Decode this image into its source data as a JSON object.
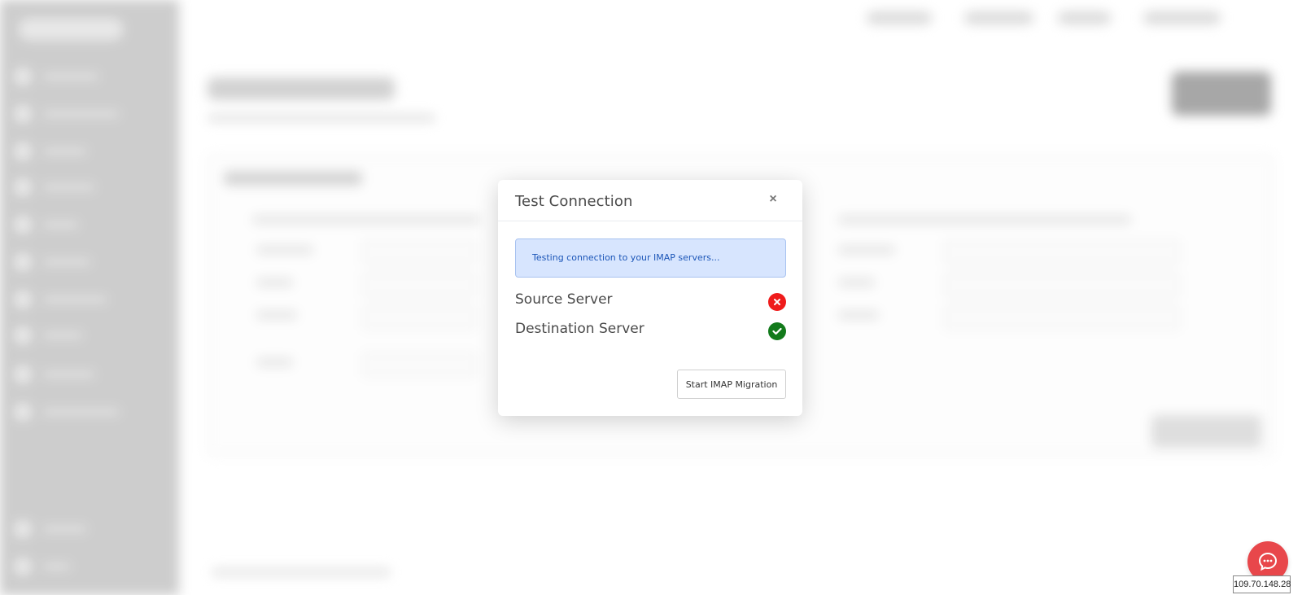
{
  "modal": {
    "title": "Test Connection",
    "close_label": "×",
    "alert_text": "Testing connection to your IMAP servers...",
    "servers": [
      {
        "label": "Source Server",
        "status": "failed",
        "icon": "x-icon"
      },
      {
        "label": "Destination Server",
        "status": "success",
        "icon": "check-icon"
      }
    ],
    "start_button_label": "Start IMAP Migration"
  },
  "chat": {
    "icon": "chat-bubble-icon"
  },
  "ip_label": "109.70.148.28",
  "colors": {
    "alert_bg": "#d7e5fe",
    "alert_text": "#1c56b8",
    "fail": "#ef1b1b",
    "success": "#127a1b",
    "chat": "#e8474b",
    "sidebar": "#c9c9c9"
  }
}
